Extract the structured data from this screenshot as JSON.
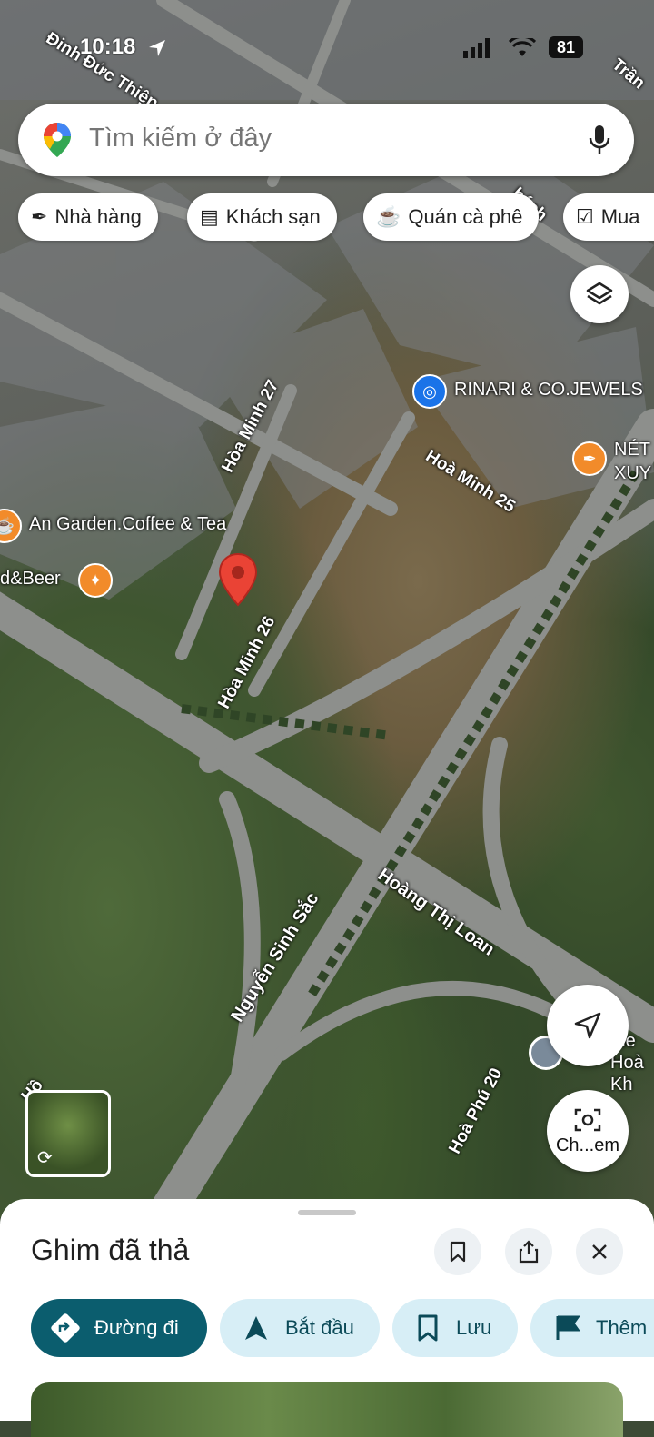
{
  "status_bar": {
    "time": "10:18",
    "battery": "81"
  },
  "search": {
    "placeholder": "Tìm kiếm ở đây"
  },
  "chips": [
    {
      "label": "Nhà hàng",
      "icon": "fork-knife-icon"
    },
    {
      "label": "Khách sạn",
      "icon": "bed-icon"
    },
    {
      "label": "Quán cà phê",
      "icon": "coffee-cup-icon"
    },
    {
      "label": "Mua",
      "icon": "shopping-bag-icon"
    }
  ],
  "map": {
    "streets": {
      "dinh_duc_thien": "Đinh Đức Thiện",
      "hoa_minh_27": "Hòa Minh 27",
      "hoa_minh_25": "Hoà Minh 25",
      "hoa_minh_26": "Hòa Minh 26",
      "hoang_thi_loan": "Hoàng Thị Loan",
      "nguyen_sinh_sac": "Nguyễn Sinh Sắc",
      "hoa_phu_20": "Hoà Phú 20",
      "tran": "Trần",
      "bach": "bách",
      "hoa_minh_partial": "Hoà Minh 25",
      "he": "Hồ"
    },
    "pois": [
      {
        "label": "RINARI & CO.JEWELS",
        "icon": "shopping-bag-icon",
        "color": "#1a73e8"
      },
      {
        "label": "NÉT XUY",
        "icon": "fork-knife-icon",
        "color": "#f28b2a"
      },
      {
        "label": "An Garden.Coffee & Tea",
        "icon": "coffee-cup-icon",
        "color": "#f28b2a"
      },
      {
        "label": "d&Beer",
        "icon": "cocktail-icon",
        "color": "#f28b2a"
      },
      {
        "label": "tne Hoà Kh",
        "icon": "place-icon",
        "color": "#7a8a9a"
      }
    ],
    "pin_color": "#ea4335"
  },
  "controls": {
    "lens_label": "Ch...em"
  },
  "sheet": {
    "title": "Ghim đã thả",
    "actions": [
      {
        "label": "Đường đi",
        "icon": "directions-icon"
      },
      {
        "label": "Bắt đầu",
        "icon": "navigation-arrow-icon"
      },
      {
        "label": "Lưu",
        "icon": "bookmark-icon"
      },
      {
        "label": "Thêm",
        "icon": "flag-icon"
      }
    ]
  },
  "colors": {
    "primary": "#0b5d6e",
    "secondary_bg": "#d7eef6"
  }
}
